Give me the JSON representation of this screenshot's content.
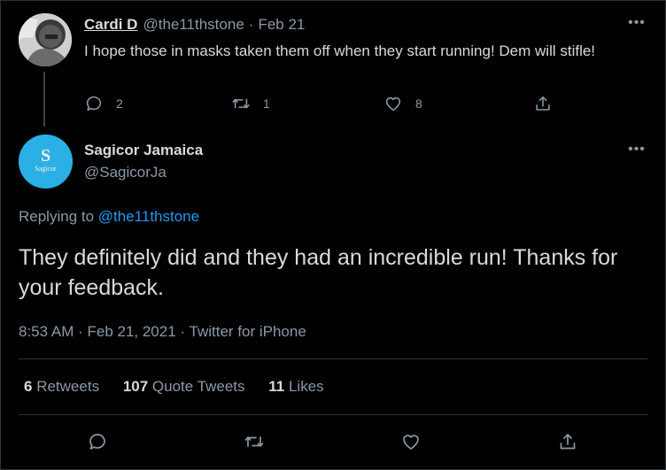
{
  "parent_tweet": {
    "author_name": "Cardi D",
    "handle": "@the11thstone",
    "separator": "·",
    "date": "Feb 21",
    "text": "I hope those in masks taken them off when they start running!  Dem will stifle!",
    "reply_count": "2",
    "retweet_count": "1",
    "like_count": "8",
    "more_label": "•••"
  },
  "main_tweet": {
    "author_name": "Sagicor Jamaica",
    "handle": "@SagicorJa",
    "avatar_logo_letter": "S",
    "avatar_logo_text": "Sagicor",
    "more_label": "•••",
    "replying_prefix": "Replying to ",
    "replying_to": "@the11thstone",
    "text": "They definitely did and they had an incredible run! Thanks for your feedback.",
    "time": "8:53 AM",
    "separator1": " · ",
    "date": "Feb 21, 2021",
    "separator2": " · ",
    "source": "Twitter for iPhone",
    "stats": {
      "retweets_count": "6",
      "retweets_label": "Retweets",
      "quote_count": "107",
      "quote_label": "Quote Tweets",
      "likes_count": "11",
      "likes_label": "Likes"
    }
  },
  "colors": {
    "background": "#000000",
    "text_primary": "#d9d9d9",
    "text_secondary": "#8b98a5",
    "link": "#1d9bf0",
    "avatar_brand": "#2ab0e4",
    "divider": "#2f3336"
  },
  "icons": [
    "reply-icon",
    "retweet-icon",
    "like-icon",
    "share-icon",
    "more-icon"
  ]
}
